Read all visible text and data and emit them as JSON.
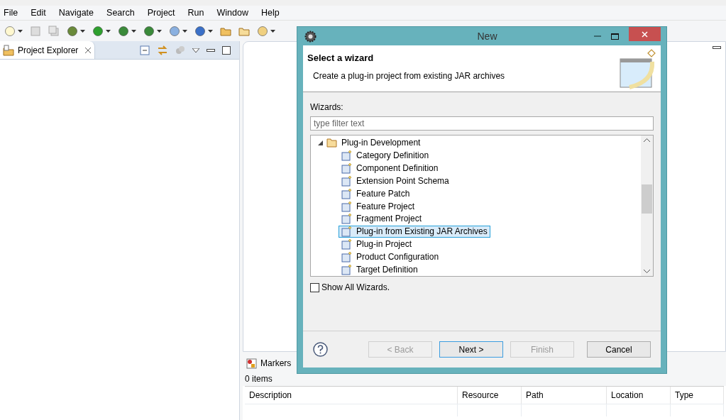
{
  "menu": [
    "File",
    "Edit",
    "Navigate",
    "Search",
    "Project",
    "Run",
    "Window",
    "Help"
  ],
  "project_explorer": {
    "title": "Project Explorer"
  },
  "markers": {
    "title": "Markers",
    "count": "0 items",
    "columns": [
      "Description",
      "Resource",
      "Path",
      "Location",
      "Type"
    ]
  },
  "dialog": {
    "title": "New",
    "heading": "Select a wizard",
    "description": "Create a plug-in project from existing JAR archives",
    "wizards_label": "Wizards:",
    "filter": {
      "placeholder": "type filter text"
    },
    "tree": [
      {
        "label": "Plug-in Development",
        "expanded": true,
        "children": [
          {
            "label": "Category Definition",
            "selected": false
          },
          {
            "label": "Component Definition",
            "selected": false
          },
          {
            "label": "Extension Point Schema",
            "selected": false
          },
          {
            "label": "Feature Patch",
            "selected": false
          },
          {
            "label": "Feature Project",
            "selected": false
          },
          {
            "label": "Fragment Project",
            "selected": false
          },
          {
            "label": "Plug-in from Existing JAR Archives",
            "selected": true
          },
          {
            "label": "Plug-in Project",
            "selected": false
          },
          {
            "label": "Product Configuration",
            "selected": false
          },
          {
            "label": "Target Definition",
            "selected": false
          }
        ]
      }
    ],
    "show_all": {
      "label": "Show All Wizards.",
      "checked": false
    },
    "buttons": [
      {
        "label": "< Back",
        "disabled": true,
        "default": false
      },
      {
        "label": "Next >",
        "disabled": false,
        "default": true
      },
      {
        "label": "Finish",
        "disabled": true,
        "default": false
      },
      {
        "label": "Cancel",
        "disabled": false,
        "default": false
      }
    ]
  }
}
